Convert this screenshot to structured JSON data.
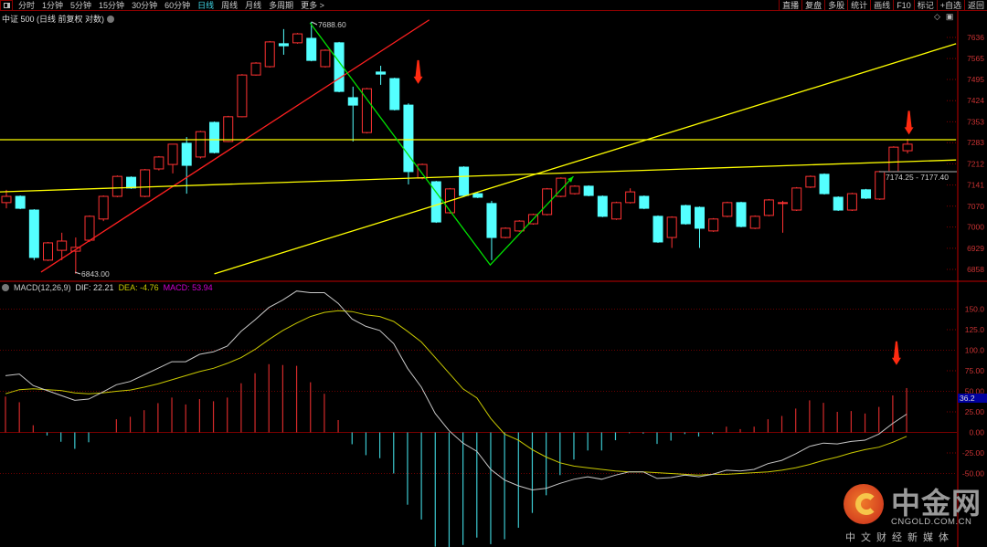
{
  "toolbar": {
    "periods": [
      "分时",
      "1分钟",
      "5分钟",
      "15分钟",
      "30分钟",
      "60分钟",
      "日线",
      "周线",
      "月线",
      "多周期",
      "更多 >"
    ],
    "active": "日线",
    "right_buttons": [
      "直播",
      "复盘",
      "多股",
      "统计",
      "画线",
      "F10",
      "标记",
      "+自选",
      "返回"
    ]
  },
  "title": "中证 500 (日线 前复权 对数)",
  "price_axis": [
    "7636",
    "7565",
    "7495",
    "7424",
    "7353",
    "7283",
    "7212",
    "7141",
    "7070",
    "7000",
    "6929",
    "6858"
  ],
  "annotations": {
    "high_label": "7688.60",
    "low_label": "6843.00",
    "range_label": "7174.25 - 7177.40",
    "macd_cursor": "36.2"
  },
  "macd_header": {
    "name": "MACD(12,26,9)",
    "dif": "DIF: 22.21",
    "dea": "DEA: -4.76",
    "macd": "MACD: 53.94"
  },
  "macd_axis": [
    "150.0",
    "125.0",
    "100.0",
    "75.00",
    "50.00",
    "25.00",
    "0.00",
    "-25.00",
    "-50.00"
  ],
  "logo": {
    "cn": "中金网",
    "en": "CNGOLD.COM.CN",
    "sub": "中文财经新媒体"
  },
  "colors": {
    "up": "#ff3232",
    "down": "#54ffff",
    "dif": "#c8c8c8",
    "dea": "#c8c800",
    "axis": "#c00000",
    "trend_red": "#ff2020",
    "trend_yellow": "#ffff00",
    "trend_green": "#00e000"
  },
  "chart_data": {
    "type": "candlestick",
    "price_range": [
      6858,
      7636
    ],
    "candles_ohlc": [
      [
        7082,
        7103,
        7125,
        7063
      ],
      [
        7103,
        7063,
        7106,
        7060
      ],
      [
        7057,
        6898,
        7060,
        6889
      ],
      [
        6889,
        6947,
        6950,
        6886
      ],
      [
        6922,
        6953,
        6981,
        6889
      ],
      [
        6919,
        6932,
        6965,
        6843
      ],
      [
        6956,
        7036,
        7039,
        6950
      ],
      [
        7027,
        7103,
        7106,
        7020
      ],
      [
        7103,
        7170,
        7173,
        7100
      ],
      [
        7167,
        7131,
        7170,
        7128
      ],
      [
        7103,
        7192,
        7195,
        7100
      ],
      [
        7195,
        7235,
        7238,
        7190
      ],
      [
        7210,
        7278,
        7278,
        7180
      ],
      [
        7281,
        7207,
        7302,
        7112
      ],
      [
        7235,
        7320,
        7323,
        7230
      ],
      [
        7351,
        7250,
        7354,
        7247
      ],
      [
        7287,
        7370,
        7373,
        7285
      ],
      [
        7370,
        7510,
        7513,
        7368
      ],
      [
        7510,
        7550,
        7553,
        7508
      ],
      [
        7538,
        7621,
        7624,
        7535
      ],
      [
        7615,
        7608,
        7664,
        7578
      ],
      [
        7618,
        7648,
        7651,
        7615
      ],
      [
        7633,
        7559,
        7688.6,
        7556
      ],
      [
        7538,
        7593,
        7596,
        7535
      ],
      [
        7618,
        7455,
        7621,
        7452
      ],
      [
        7434,
        7409,
        7471,
        7287
      ],
      [
        7317,
        7464,
        7467,
        7314
      ],
      [
        7520,
        7513,
        7541,
        7477
      ],
      [
        7498,
        7394,
        7501,
        7391
      ],
      [
        7409,
        7186,
        7415,
        7143
      ],
      [
        7164,
        7210,
        7213,
        7160
      ],
      [
        7152,
        7017,
        7155,
        7014
      ],
      [
        7048,
        7128,
        7131,
        7045
      ],
      [
        7201,
        7106,
        7204,
        7103
      ],
      [
        7112,
        7100,
        7115,
        7097
      ],
      [
        7079,
        6965,
        7088,
        6889
      ],
      [
        6965,
        6996,
        6999,
        6962
      ],
      [
        6987,
        7020,
        7023,
        6984
      ],
      [
        7011,
        7042,
        7045,
        7008
      ],
      [
        7042,
        7128,
        7131,
        7039
      ],
      [
        7103,
        7164,
        7167,
        7100
      ],
      [
        7112,
        7137,
        7140,
        7109
      ],
      [
        7137,
        7106,
        7140,
        7103
      ],
      [
        7103,
        7036,
        7106,
        7033
      ],
      [
        7027,
        7082,
        7085,
        7024
      ],
      [
        7082,
        7118,
        7130,
        7079
      ],
      [
        7103,
        7063,
        7106,
        7060
      ],
      [
        7036,
        6950,
        7039,
        6947
      ],
      [
        6965,
        7033,
        7036,
        6930
      ],
      [
        7072,
        7011,
        7075,
        7008
      ],
      [
        7066,
        6996,
        7069,
        6930
      ],
      [
        6987,
        7027,
        7030,
        6984
      ],
      [
        7036,
        7082,
        7085,
        7033
      ],
      [
        7082,
        7002,
        7085,
        6999
      ],
      [
        6996,
        7036,
        7039,
        6993
      ],
      [
        7039,
        7091,
        7094,
        7036
      ],
      [
        7080,
        7082,
        7088,
        6981
      ],
      [
        7057,
        7131,
        7134,
        7054
      ],
      [
        7134,
        7170,
        7173,
        7131
      ],
      [
        7177,
        7112,
        7180,
        7109
      ],
      [
        7100,
        7057,
        7103,
        7054
      ],
      [
        7057,
        7112,
        7115,
        7054
      ],
      [
        7125,
        7097,
        7128,
        7094
      ],
      [
        7094,
        7186,
        7189,
        7091
      ],
      [
        7186,
        7268,
        7271,
        7183
      ],
      [
        7256,
        7278,
        7296,
        7247
      ]
    ],
    "trendlines": [
      {
        "color": "trend_red",
        "points": [
          [
            2.5,
            6849
          ],
          [
            30.5,
            7695
          ]
        ]
      },
      {
        "color": "trend_yellow",
        "points": [
          [
            -0.5,
            7293
          ],
          [
            68.5,
            7293
          ]
        ]
      },
      {
        "color": "trend_yellow",
        "points": [
          [
            -0.5,
            7118
          ],
          [
            68.5,
            7225
          ]
        ]
      },
      {
        "color": "trend_yellow",
        "points": [
          [
            15,
            6843
          ],
          [
            68.5,
            7615
          ]
        ]
      },
      {
        "color": "trend_green",
        "points": [
          [
            21.9,
            7685
          ],
          [
            34.9,
            6873
          ],
          [
            40.9,
            7170
          ]
        ],
        "arrow": true
      }
    ],
    "arrow_marks": [
      {
        "panel": "price",
        "index": 29.7,
        "value": 7480
      },
      {
        "panel": "price",
        "index": 65.1,
        "value": 7310
      },
      {
        "panel": "macd",
        "index": 64.2,
        "value": 82
      }
    ],
    "macd_range": [
      -140,
      185
    ],
    "macd_hist": [
      43.6,
      36.7,
      8.7,
      -3.8,
      -11.4,
      -20,
      -12,
      0,
      16,
      19,
      27,
      35.6,
      42.4,
      34,
      40.5,
      37.9,
      42.4,
      59.8,
      72,
      83,
      82,
      81,
      61,
      47,
      15,
      -14.4,
      -27.7,
      -31.4,
      -50,
      -88,
      -106,
      -139,
      -140,
      -137,
      -128,
      -136,
      -130,
      -116,
      -98,
      -76.5,
      -52,
      -33,
      -22,
      -22,
      -9.5,
      -1,
      -1.5,
      -14,
      -10,
      -2,
      -5,
      -2,
      7,
      4,
      7,
      16,
      20,
      29,
      39,
      36,
      25,
      26,
      23,
      31,
      45,
      53.94
    ],
    "dif": [
      69,
      71,
      57,
      51,
      45,
      39,
      40.5,
      49,
      58,
      62,
      70,
      78,
      86,
      86,
      95,
      98,
      105,
      123,
      137,
      152,
      161,
      172,
      170,
      170,
      157,
      138,
      129,
      124,
      108,
      78,
      55,
      23,
      2,
      -13,
      -23,
      -45,
      -58,
      -65,
      -70,
      -68,
      -62,
      -57,
      -54,
      -57,
      -52,
      -48,
      -48,
      -56,
      -55,
      -52,
      -54,
      -51,
      -46,
      -47,
      -45,
      -38,
      -34,
      -26,
      -17,
      -13,
      -14,
      -11,
      -9.5,
      -2,
      11,
      22.21
    ],
    "dea": [
      47,
      52,
      53,
      52,
      51,
      48,
      47,
      48,
      50,
      51.5,
      55,
      59,
      64,
      69,
      74,
      78,
      84,
      91,
      101,
      113,
      124,
      133,
      141,
      146,
      148,
      147,
      143,
      141,
      135,
      123,
      110,
      91,
      72,
      53,
      42,
      17,
      -2,
      -9.5,
      -21,
      -30,
      -37,
      -41,
      -43,
      -45,
      -47,
      -48,
      -48,
      -49,
      -50,
      -51,
      -52,
      -51,
      -51,
      -50,
      -49,
      -48,
      -46,
      -43,
      -39,
      -34,
      -30,
      -25,
      -21,
      -18,
      -12,
      -4.76
    ]
  }
}
